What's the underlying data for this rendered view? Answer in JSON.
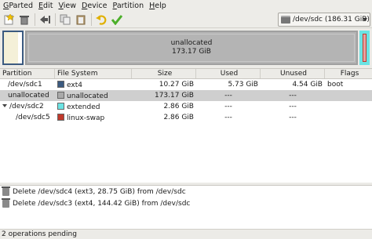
{
  "menubar": {
    "items": [
      {
        "ul": "G",
        "rest": "Parted"
      },
      {
        "ul": "E",
        "rest": "dit"
      },
      {
        "ul": "V",
        "rest": "iew"
      },
      {
        "ul": "D",
        "rest": "evice"
      },
      {
        "ul": "P",
        "rest": "artition"
      },
      {
        "ul": "H",
        "rest": "elp"
      }
    ]
  },
  "toolbar": {
    "icons": [
      "new-icon",
      "delete-icon",
      "resize-move-icon",
      "copy-icon",
      "paste-icon",
      "undo-icon",
      "apply-icon"
    ],
    "device": "/dev/sdc  (186.31 GiB)"
  },
  "diskmap": {
    "unallocated_label": "unallocated",
    "unallocated_size": "173.17 GiB"
  },
  "table": {
    "headers": [
      "Partition",
      "File System",
      "Size",
      "Used",
      "Unused",
      "Flags"
    ],
    "rows": [
      {
        "partition": "/dev/sdc1",
        "fs": "ext4",
        "color": "#3b5a80",
        "size": "10.27 GiB",
        "used": "5.73 GiB",
        "unused": "4.54 GiB",
        "flags": "boot"
      },
      {
        "partition": "unallocated",
        "fs": "unallocated",
        "color": "#a9a9a9",
        "size": "173.17 GiB",
        "used": "---",
        "unused": "---",
        "flags": ""
      },
      {
        "partition": "/dev/sdc2",
        "fs": "extended",
        "color": "#6be3e3",
        "size": "2.86 GiB",
        "used": "---",
        "unused": "---",
        "flags": ""
      },
      {
        "partition": "/dev/sdc5",
        "fs": "linux-swap",
        "color": "#c0392b",
        "size": "2.86 GiB",
        "used": "---",
        "unused": "---",
        "flags": ""
      }
    ]
  },
  "operations": [
    "Delete /dev/sdc4 (ext3, 28.75 GiB) from /dev/sdc",
    "Delete /dev/sdc3 (ext4, 144.42 GiB) from /dev/sdc"
  ],
  "status": "2 operations pending"
}
